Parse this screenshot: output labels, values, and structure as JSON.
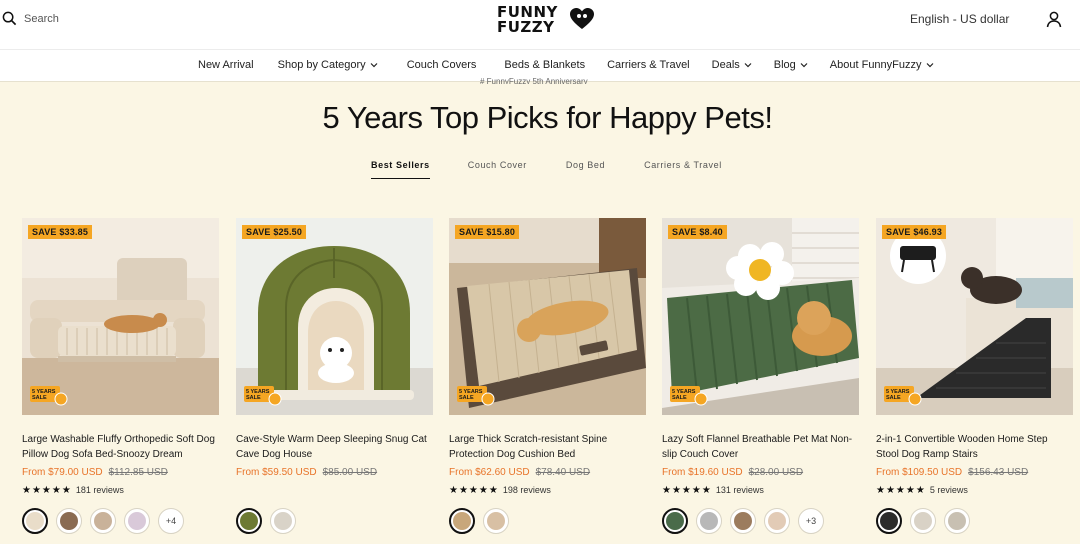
{
  "header": {
    "search_label": "Search",
    "logo_line1": "FUNNY",
    "logo_line2": "FUZZY",
    "language": "English - US dollar"
  },
  "nav": {
    "items": [
      {
        "label": "New Arrival",
        "dropdown": false
      },
      {
        "label": "Shop by Category",
        "dropdown": true
      },
      {
        "label": "Couch Covers",
        "dropdown": false
      },
      {
        "label": "Beds & Blankets",
        "dropdown": false
      },
      {
        "label": "Carriers & Travel",
        "dropdown": false
      },
      {
        "label": "Deals",
        "dropdown": true
      },
      {
        "label": "Blog",
        "dropdown": true
      },
      {
        "label": "About FunnyFuzzy",
        "dropdown": true
      }
    ]
  },
  "breadcrumb": "# FunnyFuzzy 5th Anniversary",
  "headline": "5 Years Top Picks for Happy Pets!",
  "tabs": [
    "Best Sellers",
    "Couch Cover",
    "Dog Bed",
    "Carriers & Travel"
  ],
  "badge_text": {
    "line1": "5 YEARS",
    "line2": "SALE"
  },
  "products": [
    {
      "save": "SAVE $33.85",
      "title": "Large Washable Fluffy Orthopedic Soft Dog Pillow Dog Sofa Bed-Snoozy Dream",
      "price": "From $79.00 USD",
      "was": "$112.85 USD",
      "stars": "★★★★★",
      "reviews": "181 reviews",
      "swatches": [
        "#e9ddc9",
        "#8a6b52",
        "#c9b29a",
        "#d9c9d9"
      ],
      "more": "+4"
    },
    {
      "save": "SAVE $25.50",
      "title": "Cave-Style Warm Deep Sleeping Snug Cat Cave Dog House",
      "price": "From $59.50 USD",
      "was": "$85.00 USD",
      "stars": "",
      "reviews": "",
      "swatches": [
        "#6d7a33",
        "#d9d3c8"
      ],
      "more": ""
    },
    {
      "save": "SAVE $15.80",
      "title": "Large Thick Scratch-resistant Spine Protection Dog Cushion Bed",
      "price": "From $62.60 USD",
      "was": "$78.40 USD",
      "stars": "★★★★★",
      "reviews": "198 reviews",
      "swatches": [
        "#c8a77b",
        "#d8c0a4"
      ],
      "more": ""
    },
    {
      "save": "SAVE $8.40",
      "title": "Lazy Soft Flannel Breathable Pet Mat Non-slip Couch Cover",
      "price": "From $19.60 USD",
      "was": "$28.00 USD",
      "stars": "★★★★★",
      "reviews": "131 reviews",
      "swatches": [
        "#4a6b4a",
        "#b8b8b8",
        "#9c7c5e",
        "#e2cbb6"
      ],
      "more": "+3"
    },
    {
      "save": "SAVE $46.93",
      "title": "2-in-1 Convertible Wooden Home Step Stool Dog Ramp Stairs",
      "price": "From $109.50 USD",
      "was": "$156.43 USD",
      "stars": "★★★★★",
      "reviews": "5 reviews",
      "swatches": [
        "#2b2b2b",
        "#d9d2c6",
        "#c8c0b2"
      ],
      "more": ""
    }
  ]
}
